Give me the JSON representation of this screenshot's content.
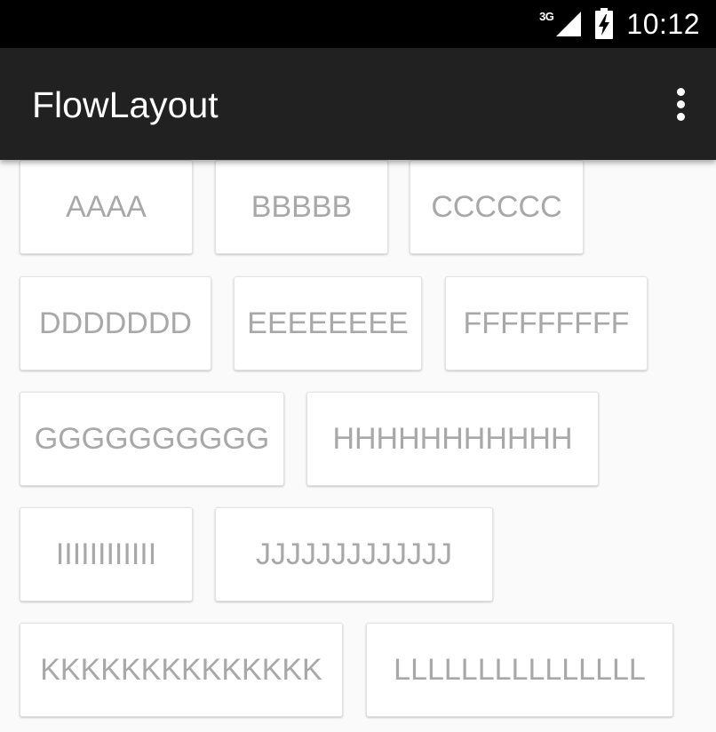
{
  "status_bar": {
    "network_type": "3G",
    "time": "10:12",
    "icons": [
      "signal-icon",
      "battery-charging-icon"
    ]
  },
  "app_bar": {
    "title": "FlowLayout",
    "menu_icon": "overflow-menu-icon"
  },
  "tags": [
    "AAAA",
    "BBBBB",
    "CCCCCC",
    "DDDDDDD",
    "EEEEEEEE",
    "FFFFFFFFF",
    "GGGGGGGGGG",
    "HHHHHHHHHHH",
    "IIIIIIIIIIII",
    "JJJJJJJJJJJJJ",
    "KKKKKKKKKKKKKK",
    "LLLLLLLLLLLLLLL"
  ],
  "colors": {
    "status_bar": "#000000",
    "app_bar": "#212121",
    "background": "#fafafa",
    "tag_background": "#ffffff",
    "tag_text": "#a8a8a8"
  }
}
